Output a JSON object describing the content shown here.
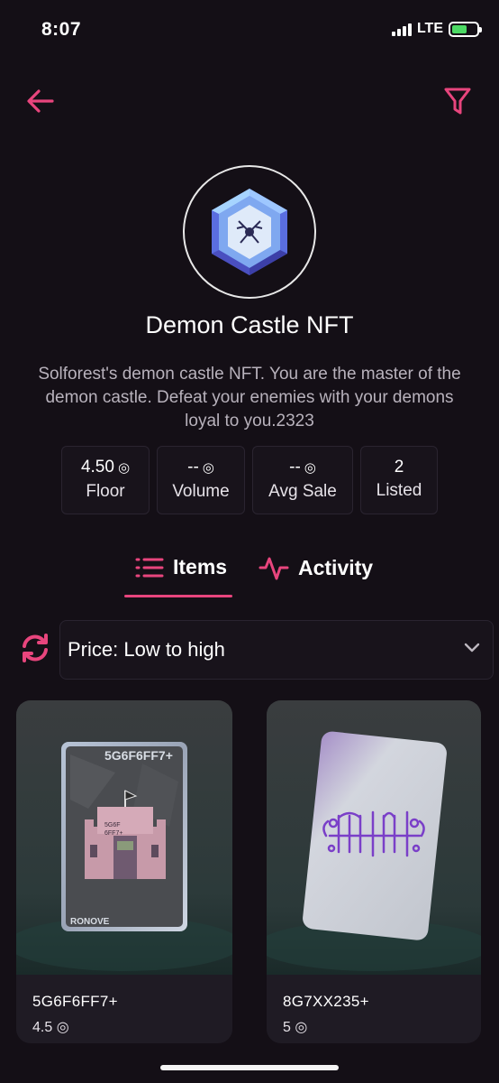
{
  "status_bar": {
    "time": "8:07",
    "network": "LTE",
    "battery_level": 0.6
  },
  "collection": {
    "title": "Demon Castle NFT",
    "description": "Solforest's demon castle NFT. You are the master of the demon castle. Defeat your enemies with your demons loyal to you.2323",
    "logo_icon": "gem-logo-icon"
  },
  "stats": [
    {
      "value": "4.50",
      "unit": "◎",
      "label": "Floor"
    },
    {
      "value": "--",
      "unit": "◎",
      "label": "Volume"
    },
    {
      "value": "--",
      "unit": "◎",
      "label": "Avg Sale"
    },
    {
      "value": "2",
      "unit": "",
      "label": "Listed"
    }
  ],
  "tabs": [
    {
      "label": "Items",
      "icon": "list-icon",
      "active": true
    },
    {
      "label": "Activity",
      "icon": "activity-icon",
      "active": false
    }
  ],
  "sort": {
    "selected": "Price: Low to high"
  },
  "items": [
    {
      "name": "5G6F6FF7+",
      "price": "4.5 ◎",
      "card_code": "5G6F6FF7+",
      "card_small_code": "5G6F\n6FF7+",
      "card_caption": "RONOVE"
    },
    {
      "name": "8G7XX235+",
      "price": "5 ◎"
    }
  ],
  "colors": {
    "accent": "#e8457d",
    "background": "#140f16",
    "panel": "#18131b",
    "border": "#2a2430"
  }
}
